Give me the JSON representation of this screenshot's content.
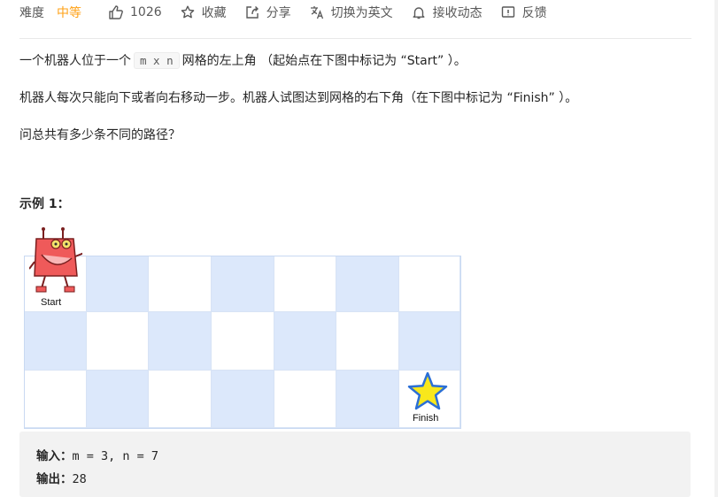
{
  "toolbar": {
    "difficulty_label": "难度",
    "difficulty_value": "中等",
    "like_count": "1026",
    "favorite_label": "收藏",
    "share_label": "分享",
    "switch_lang_label": "切换为英文",
    "subscribe_label": "接收动态",
    "feedback_label": "反馈",
    "accent_color": "#ffa116"
  },
  "description": {
    "p1_before": "一个机器人位于一个",
    "p1_code": "m x n",
    "p1_after": "网格的左上角 （起始点在下图中标记为 “Start” ）。",
    "p2": "机器人每次只能向下或者向右移动一步。机器人试图达到网格的右下角（在下图中标记为 “Finish” ）。",
    "p3": "问总共有多少条不同的路径？"
  },
  "example": {
    "title": "示例 1：",
    "figure": {
      "start_label": "Start",
      "finish_label": "Finish",
      "rows": 3,
      "cols": 7,
      "cell_colors": {
        "blue": "#dce8fb",
        "white": "#ffffff"
      }
    },
    "input_key": "输入：",
    "input_value": "m = 3, n = 7",
    "output_key": "输出：",
    "output_value": "28"
  }
}
